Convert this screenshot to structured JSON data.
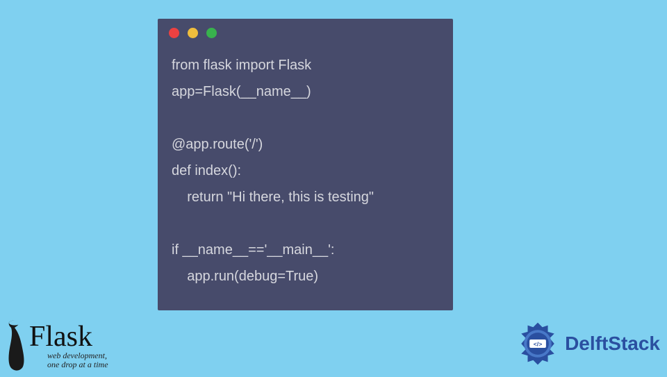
{
  "code": {
    "lines": "from flask import Flask\napp=Flask(__name__)\n\n@app.route('/')\ndef index():\n    return \"Hi there, this is testing\"\n\nif __name__=='__main__':\n    app.run(debug=True)"
  },
  "window": {
    "buttons": [
      "close",
      "minimize",
      "maximize"
    ]
  },
  "logos": {
    "flask": {
      "title": "Flask",
      "subtitle1": "web development,",
      "subtitle2": "one drop at a time"
    },
    "delftstack": {
      "text": "DelftStack",
      "badge_symbol": "</>"
    }
  },
  "colors": {
    "background": "#7fd0f0",
    "window_bg": "#474b6b",
    "code_text": "#d6d7de",
    "dot_red": "#ed4141",
    "dot_yellow": "#f0be3d",
    "dot_green": "#38b24d",
    "delft_blue": "#2a4fa0"
  }
}
